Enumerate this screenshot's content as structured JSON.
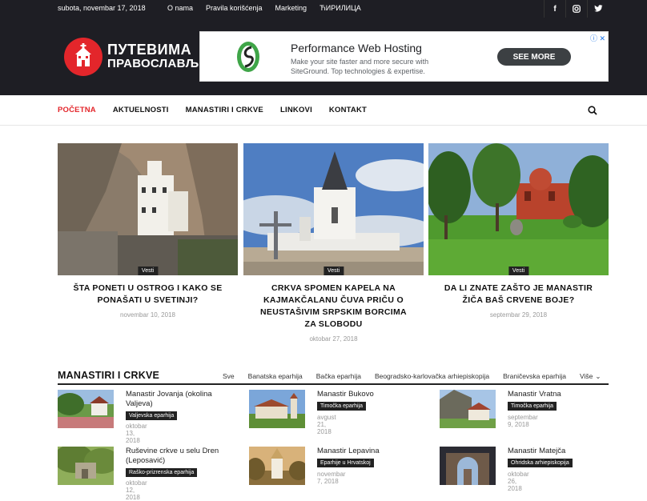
{
  "topbar": {
    "date": "subota, novembar 17, 2018",
    "links": [
      "O nama",
      "Pravila korišćenja",
      "Marketing",
      "ЋИРИЛИЦА"
    ],
    "social": [
      "facebook-icon",
      "instagram-icon",
      "twitter-icon"
    ]
  },
  "logo": {
    "line1": "ПУТЕВИМА",
    "line2": "ПРАВОСЛАВЉА"
  },
  "ad": {
    "title": "Performance Web Hosting",
    "desc": "Make your site faster and more secure with SiteGround. Top technologies & expertise.",
    "button": "SEE MORE"
  },
  "nav": {
    "items": [
      "POČETNA",
      "AKTUELNOSTI",
      "MANASTIRI I CRKVE",
      "LINKOVI",
      "KONTAKT"
    ],
    "active_index": 0
  },
  "featured": [
    {
      "tag": "Vesti",
      "title": "ŠTA PONETI U OSTROG I KAKO SE PONAŠATI U SVETINJI?",
      "date": "novembar 10, 2018"
    },
    {
      "tag": "Vesti",
      "title": "CRKVA SPOMEN KAPELA NA KAJMAKČALANU ČUVA PRIČU O NEUSTAŠIVIM SRPSKIM BORCIMA ZA SLOBODU",
      "date": "oktobar 27, 2018"
    },
    {
      "tag": "Vesti",
      "title": "DA LI ZNATE ZAŠTO JE MANASTIR ŽIČA BAŠ CRVENE BOJE?",
      "date": "septembar 29, 2018"
    }
  ],
  "section": {
    "title": "MANASTIRI I CRKVE",
    "filters": [
      "Sve",
      "Banatska eparhija",
      "Bačka eparhija",
      "Beogradsko-karlovačka arhiepiskopija",
      "Braničevska eparhija",
      "Više"
    ]
  },
  "cards": [
    {
      "title": "Manastir Jovanja (okolina Valjeva)",
      "badge": "Valjevska eparhija",
      "date": "oktobar 13, 2018"
    },
    {
      "title": "Manastir Bukovo",
      "badge": "Timočka eparhija",
      "date": "avgust 21, 2018"
    },
    {
      "title": "Manastir Vratna",
      "badge": "Timočka eparhija",
      "date": "septembar 9, 2018"
    },
    {
      "title": "Ruševine crkve u selu Dren (Leposavić)",
      "badge": "Raško-prizrenska eparhija",
      "date": "oktobar 12, 2018"
    },
    {
      "title": "Manastir Lepavina",
      "badge": "Eparhije u Hrvatskoj",
      "date": "novembar 7, 2018"
    },
    {
      "title": "Manastir Matejča",
      "badge": "Ohridska arhiepiskopija",
      "date": "oktobar 26, 2018"
    }
  ]
}
